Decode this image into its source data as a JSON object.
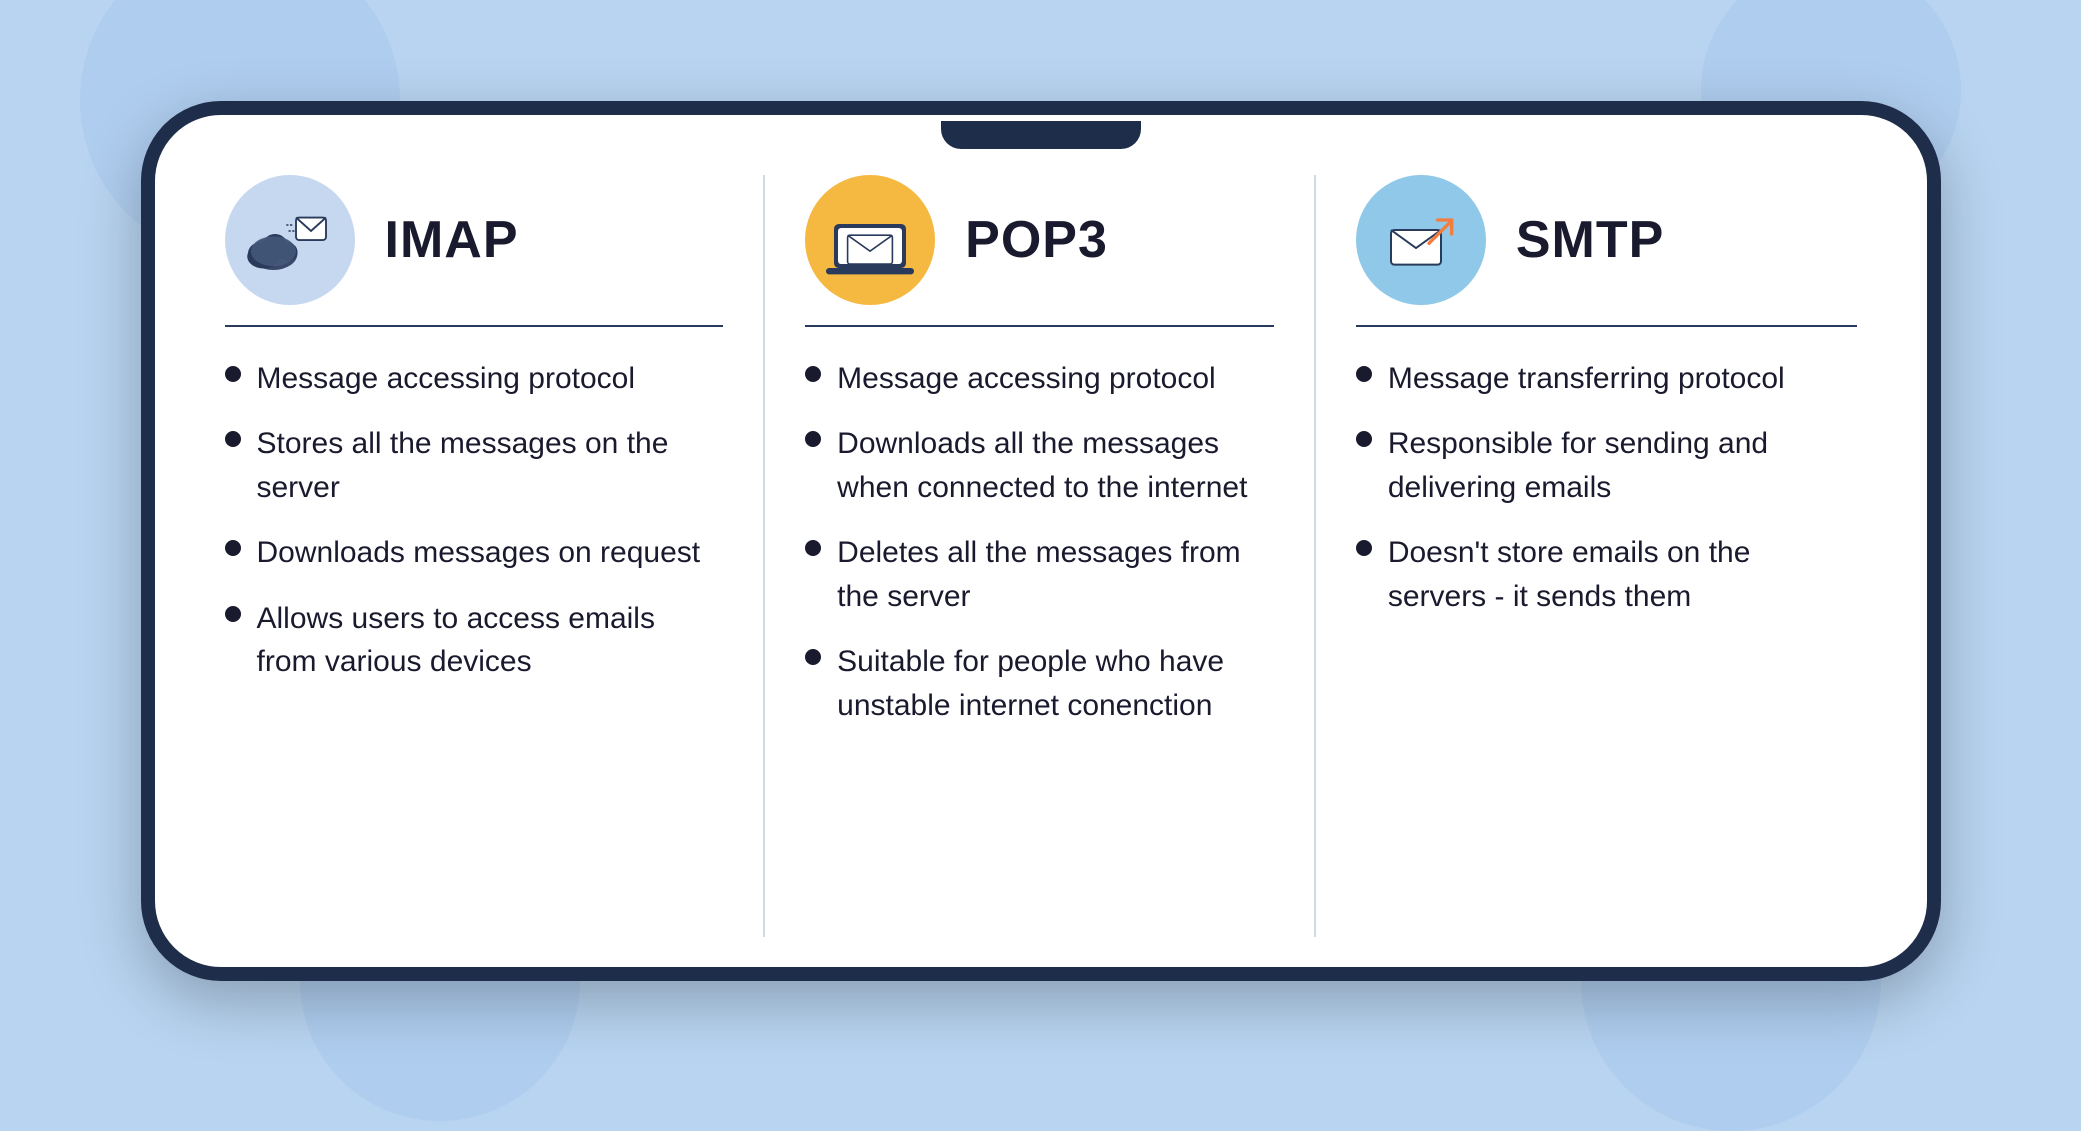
{
  "protocols": [
    {
      "id": "imap",
      "title": "IMAP",
      "icon_type": "cloud-envelope",
      "icon_bg": "blue",
      "bullets": [
        "Message accessing protocol",
        "Stores all the messages on the server",
        "Downloads messages on request",
        "Allows users to access emails from various devices"
      ]
    },
    {
      "id": "pop3",
      "title": "POP3",
      "icon_type": "laptop-envelope",
      "icon_bg": "orange",
      "bullets": [
        "Message accessing protocol",
        "Downloads all the messages when connected to the internet",
        "Deletes all the messages from the server",
        "Suitable for people who have unstable internet conenction"
      ]
    },
    {
      "id": "smtp",
      "title": "SMTP",
      "icon_type": "envelope-arrow",
      "icon_bg": "teal",
      "bullets": [
        "Message transferring protocol",
        "Responsible for sending and delivering emails",
        "Doesn't store emails on the servers - it sends them"
      ]
    }
  ]
}
